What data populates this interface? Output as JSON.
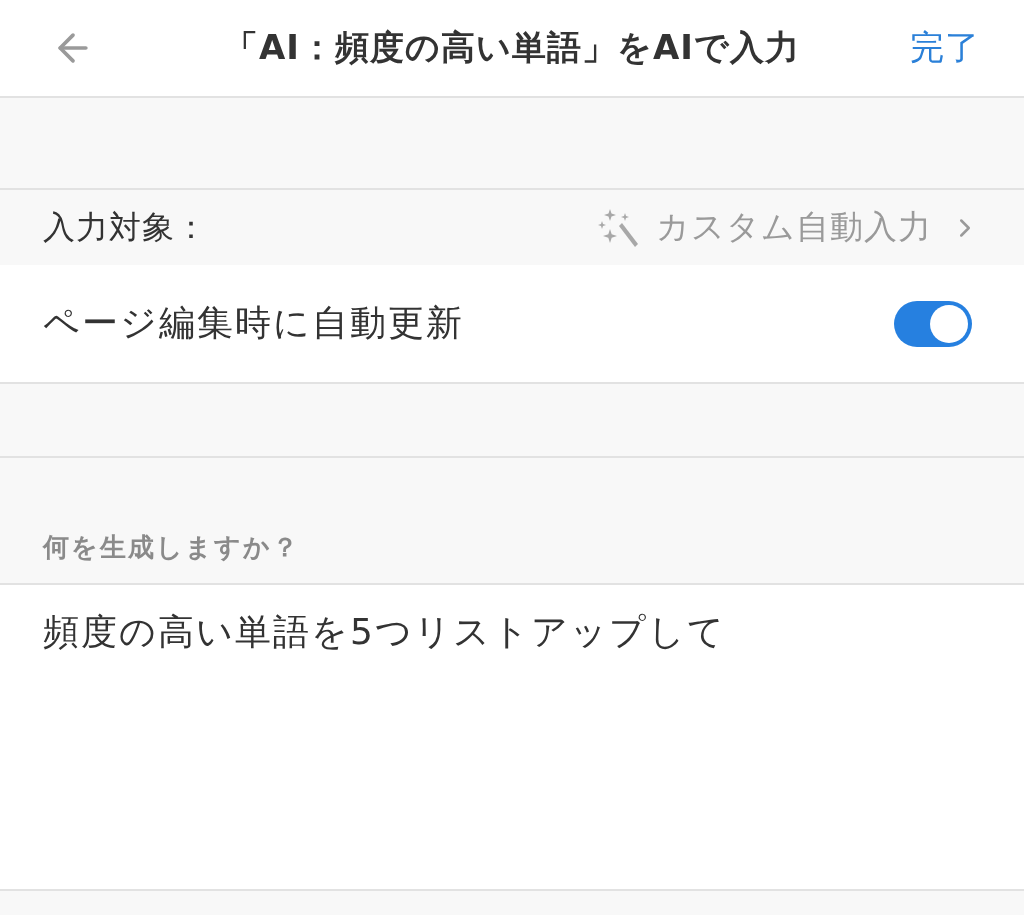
{
  "header": {
    "title": "「AI：頻度の高い単語」をAIで入力",
    "done_button": "完了"
  },
  "target_row": {
    "label": "入力対象：",
    "value": "カスタム自動入力"
  },
  "auto_update": {
    "label": "ページ編集時に自動更新",
    "on": true
  },
  "prompt": {
    "label": "何を生成しますか？",
    "value": "頻度の高い単語を5つリストアップして"
  }
}
